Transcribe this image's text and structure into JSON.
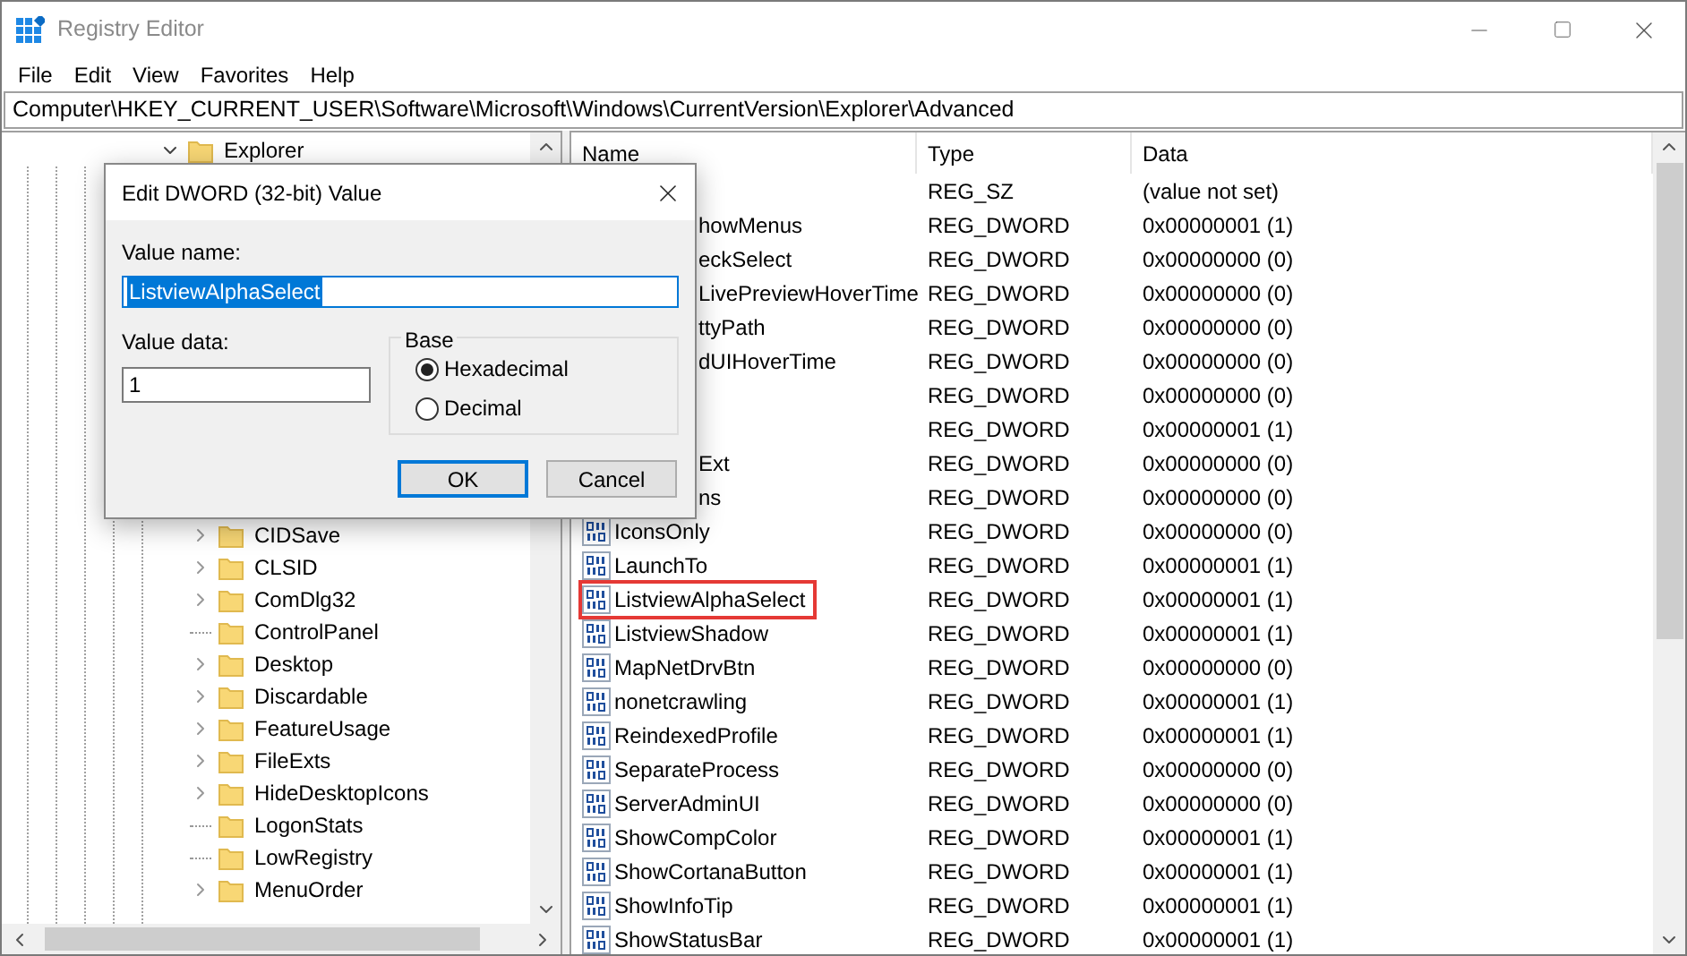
{
  "window": {
    "title": "Registry Editor"
  },
  "menu": [
    "File",
    "Edit",
    "View",
    "Favorites",
    "Help"
  ],
  "address": "Computer\\HKEY_CURRENT_USER\\Software\\Microsoft\\Windows\\CurrentVersion\\Explorer\\Advanced",
  "tree": [
    {
      "label": "Explorer",
      "expanded": true,
      "children": [
        {
          "label": "CIDSave",
          "has_children": true
        },
        {
          "label": "CLSID",
          "has_children": true
        },
        {
          "label": "ComDlg32",
          "has_children": true
        },
        {
          "label": "ControlPanel",
          "has_children": false
        },
        {
          "label": "Desktop",
          "has_children": true
        },
        {
          "label": "Discardable",
          "has_children": true
        },
        {
          "label": "FeatureUsage",
          "has_children": true
        },
        {
          "label": "FileExts",
          "has_children": true
        },
        {
          "label": "HideDesktopIcons",
          "has_children": true
        },
        {
          "label": "LogonStats",
          "has_children": false
        },
        {
          "label": "LowRegistry",
          "has_children": false
        },
        {
          "label": "MenuOrder",
          "has_children": true
        }
      ]
    }
  ],
  "columns": [
    "Name",
    "Type",
    "Data"
  ],
  "rows": [
    {
      "kind": "hidden",
      "type": "REG_SZ",
      "data": "(value not set)"
    },
    {
      "kind": "clipped",
      "name": "howMenus",
      "type": "REG_DWORD",
      "data": "0x00000001 (1)",
      "highlighted": false
    },
    {
      "kind": "clipped",
      "name": "eckSelect",
      "type": "REG_DWORD",
      "data": "0x00000000 (0)",
      "highlighted": false
    },
    {
      "kind": "clipped",
      "name": "LivePreviewHoverTime",
      "type": "REG_DWORD",
      "data": "0x00000000 (0)",
      "highlighted": false
    },
    {
      "kind": "clipped",
      "name": "ttyPath",
      "type": "REG_DWORD",
      "data": "0x00000000 (0)",
      "highlighted": false
    },
    {
      "kind": "clipped",
      "name": "dUIHoverTime",
      "type": "REG_DWORD",
      "data": "0x00000000 (0)",
      "highlighted": false
    },
    {
      "kind": "hidden",
      "type": "REG_DWORD",
      "data": "0x00000000 (0)"
    },
    {
      "kind": "hidden",
      "type": "REG_DWORD",
      "data": "0x00000001 (1)"
    },
    {
      "kind": "clipped",
      "name": "Ext",
      "type": "REG_DWORD",
      "data": "0x00000000 (0)",
      "highlighted": false
    },
    {
      "kind": "clipped",
      "name": "ns",
      "type": "REG_DWORD",
      "data": "0x00000000 (0)",
      "highlighted": false
    },
    {
      "kind": "full",
      "name": "IconsOnly",
      "type": "REG_DWORD",
      "data": "0x00000000 (0)",
      "highlighted": false
    },
    {
      "kind": "full",
      "name": "LaunchTo",
      "type": "REG_DWORD",
      "data": "0x00000001 (1)",
      "highlighted": false
    },
    {
      "kind": "full",
      "name": "ListviewAlphaSelect",
      "type": "REG_DWORD",
      "data": "0x00000001 (1)",
      "highlighted": true
    },
    {
      "kind": "full",
      "name": "ListviewShadow",
      "type": "REG_DWORD",
      "data": "0x00000001 (1)",
      "highlighted": false
    },
    {
      "kind": "full",
      "name": "MapNetDrvBtn",
      "type": "REG_DWORD",
      "data": "0x00000000 (0)",
      "highlighted": false
    },
    {
      "kind": "full",
      "name": "nonetcrawling",
      "type": "REG_DWORD",
      "data": "0x00000001 (1)",
      "highlighted": false
    },
    {
      "kind": "full",
      "name": "ReindexedProfile",
      "type": "REG_DWORD",
      "data": "0x00000001 (1)",
      "highlighted": false
    },
    {
      "kind": "full",
      "name": "SeparateProcess",
      "type": "REG_DWORD",
      "data": "0x00000000 (0)",
      "highlighted": false
    },
    {
      "kind": "full",
      "name": "ServerAdminUI",
      "type": "REG_DWORD",
      "data": "0x00000000 (0)",
      "highlighted": false
    },
    {
      "kind": "full",
      "name": "ShowCompColor",
      "type": "REG_DWORD",
      "data": "0x00000001 (1)",
      "highlighted": false
    },
    {
      "kind": "full",
      "name": "ShowCortanaButton",
      "type": "REG_DWORD",
      "data": "0x00000001 (1)",
      "highlighted": false
    },
    {
      "kind": "full",
      "name": "ShowInfoTip",
      "type": "REG_DWORD",
      "data": "0x00000001 (1)",
      "highlighted": false
    },
    {
      "kind": "full",
      "name": "ShowStatusBar",
      "type": "REG_DWORD",
      "data": "0x00000001 (1)",
      "highlighted": false
    }
  ],
  "dialog": {
    "title": "Edit DWORD (32-bit) Value",
    "value_name_label": "Value name:",
    "value_name": "ListviewAlphaSelect",
    "value_data_label": "Value data:",
    "value_data": "1",
    "base_label": "Base",
    "base_options": [
      {
        "label": "Hexadecimal",
        "selected": true
      },
      {
        "label": "Decimal",
        "selected": false
      }
    ],
    "buttons": [
      {
        "label": "OK",
        "default": true
      },
      {
        "label": "Cancel",
        "default": false
      }
    ]
  }
}
